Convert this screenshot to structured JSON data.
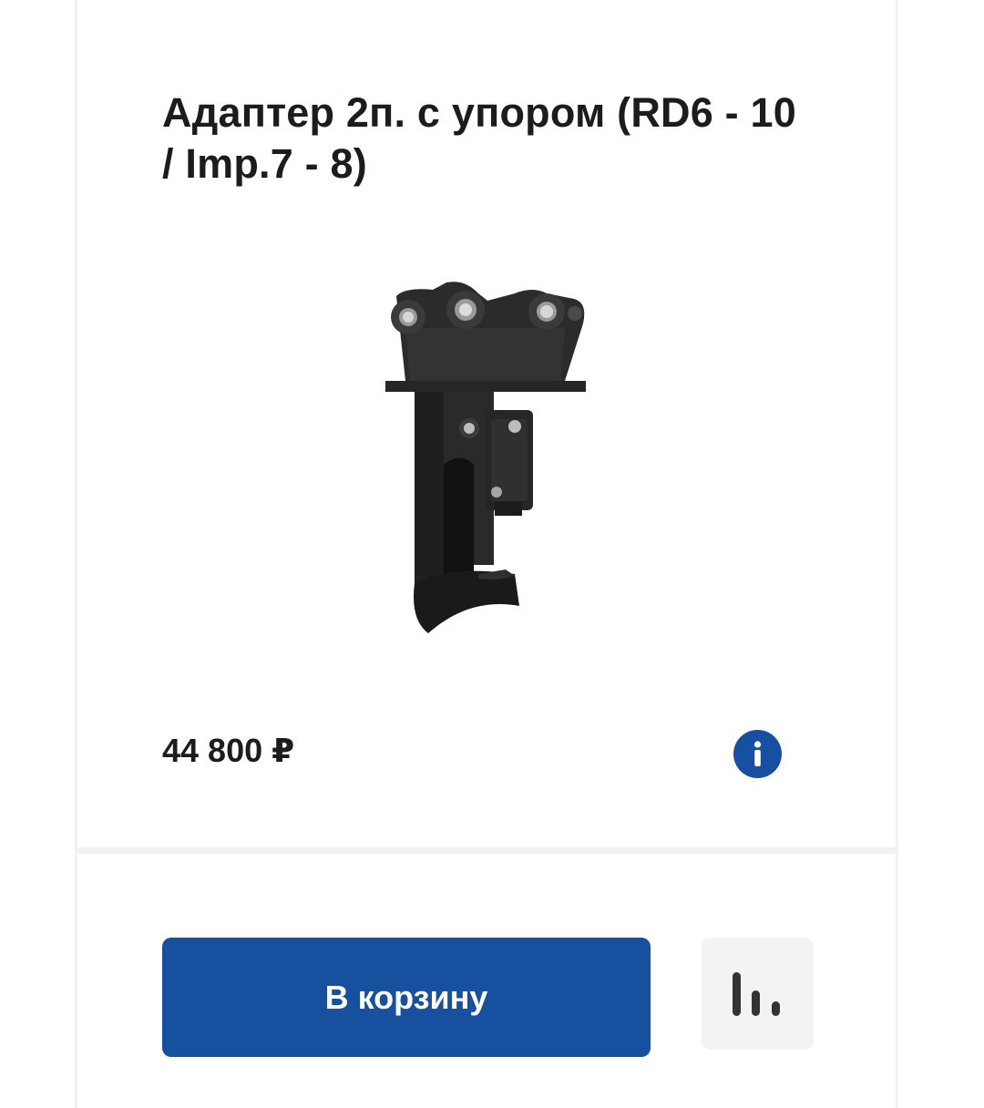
{
  "product": {
    "title": "Адаптер 2п. с упором (RD6 - 10 / Imp.7 - 8)",
    "price": "44 800 ₽",
    "image_alt": "adapter-product-photo"
  },
  "actions": {
    "add_to_cart_label": "В корзину",
    "info_icon": "info-icon",
    "compare_icon": "compare-chart-icon"
  },
  "colors": {
    "primary": "#16509f",
    "text": "#1c1c1c",
    "compare_bg": "#f3f3f3"
  }
}
